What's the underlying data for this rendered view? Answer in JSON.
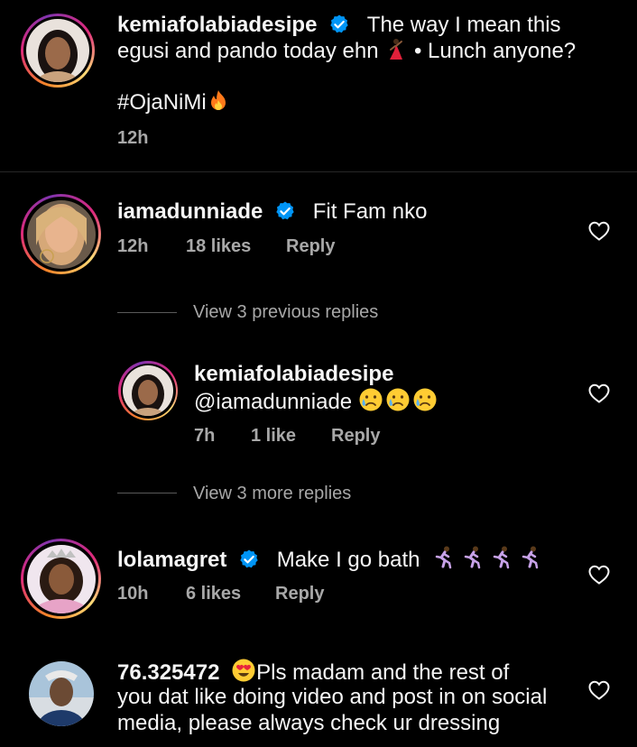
{
  "caption": {
    "username": "kemiafolabiadesipe",
    "text_line1": "The way I mean this",
    "text_line2": "egusi and pando today ehn",
    "text_line2_tail": "• Lunch anyone?",
    "hashtag": "#OjaNiMi",
    "time": "12h"
  },
  "comments": [
    {
      "username": "iamadunniade",
      "text": "Fit Fam nko",
      "time": "12h",
      "likes": "18 likes",
      "reply": "Reply"
    },
    {
      "username": "lolamagret",
      "text": "Make I go bath",
      "time": "10h",
      "likes": "6 likes",
      "reply": "Reply"
    },
    {
      "username": "76.325472",
      "text_line1": "Pls madam and the rest of",
      "text_line2": "you dat like doing video and post in on social",
      "text_line3": "media, please always check ur dressing"
    }
  ],
  "replies": {
    "view_previous": "View 3 previous replies",
    "view_more": "View 3 more replies",
    "items": [
      {
        "username": "kemiafolabiadesipe",
        "text": "@iamadunniade",
        "time": "7h",
        "likes": "1 like",
        "reply": "Reply"
      }
    ]
  },
  "icons": {
    "verified": "verified-badge-icon",
    "heart": "heart-outline-icon",
    "dancer": "dancer-emoji",
    "fire": "fire-emoji",
    "crying": "crying-face-emoji",
    "runner": "running-woman-emoji",
    "heart_eyes": "heart-eyes-emoji"
  },
  "colors": {
    "background": "#000000",
    "text": "#f5f5f5",
    "secondary": "#a8a8a8",
    "verified": "#0095f6"
  }
}
